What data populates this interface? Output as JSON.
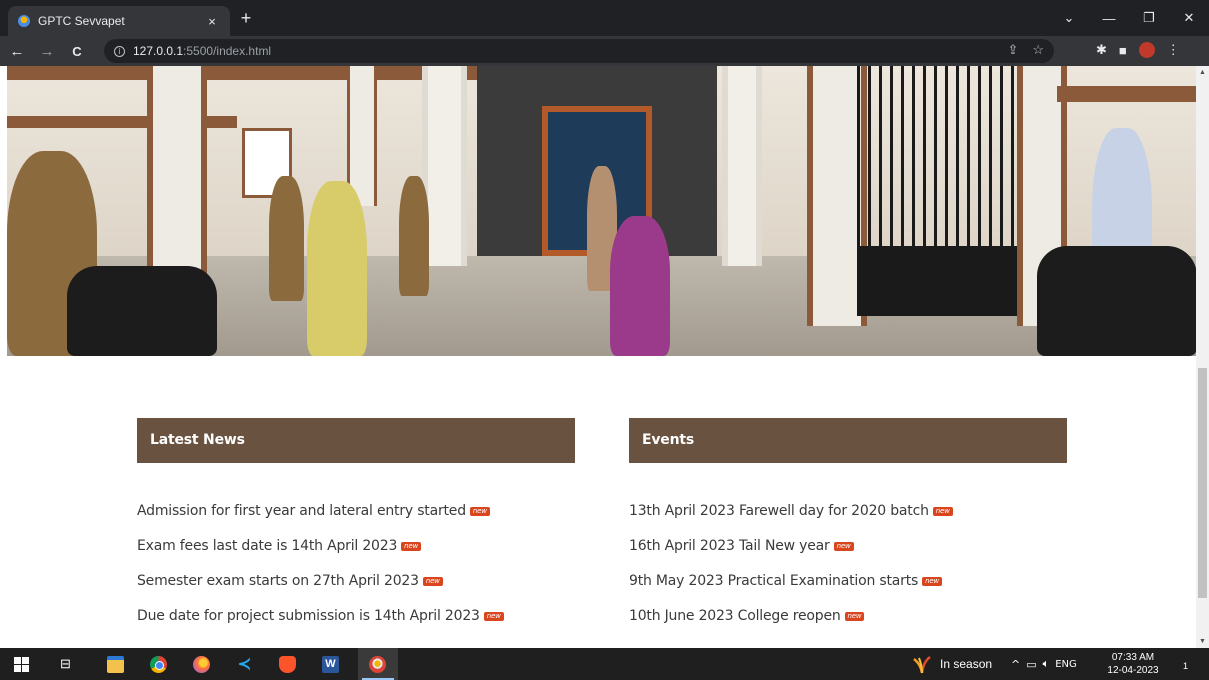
{
  "browser": {
    "tab_title": "GPTC Sevvapet",
    "tab_close": "×",
    "new_tab": "+",
    "window_controls": {
      "dropdown": "⌄",
      "minimize": "—",
      "restore": "❐",
      "close": "✕"
    },
    "nav": {
      "back": "←",
      "forward": "→",
      "reload": "C"
    },
    "url_host": "127.0.0.1",
    "url_path": ":5500/index.html",
    "omnibox_icons": [
      "share-icon",
      "star-icon"
    ],
    "extension_icons": [
      "puzzle-icon",
      "sidepanel-icon",
      "brave-extension-icon",
      "menu-icon"
    ]
  },
  "page": {
    "hero_image": "campus-entrance-photo",
    "latest_news": {
      "heading": "Latest News",
      "items": [
        "Admission for first year and lateral entry started",
        "Exam fees last date is 14th April 2023",
        "Semester exam starts on 27th April 2023",
        "Due date for project submission is 14th April 2023"
      ]
    },
    "events": {
      "heading": "Events",
      "items": [
        "13th April 2023 Farewell day for 2020 batch",
        "16th April 2023 Tail New year",
        "9th May 2023 Practical Examination starts",
        "10th June 2023 College reopen"
      ]
    },
    "badge_label": "new",
    "colors": {
      "section_header_bg": "#6a5240",
      "badge_bg": "#d9461e"
    }
  },
  "taskbar": {
    "apps": [
      "windows-start-icon",
      "task-view-icon",
      "file-explorer-icon",
      "chrome-icon",
      "firefox-icon",
      "vscode-icon",
      "brave-icon",
      "word-icon",
      "chrome-active-icon"
    ],
    "word_letter": "W",
    "weather_text": "In season",
    "tray": {
      "chevron": "^",
      "language": "ENG"
    },
    "time": "07:33 AM",
    "date": "12-04-2023",
    "notification_count": "1"
  }
}
